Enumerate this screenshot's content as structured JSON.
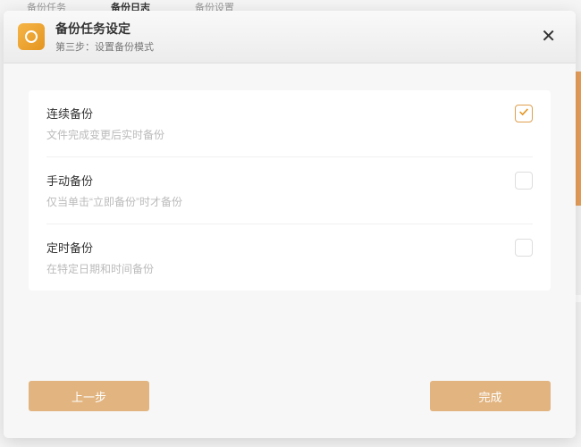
{
  "bgTabs": [
    "备份任务",
    "备份日志",
    "备份设置"
  ],
  "header": {
    "title": "备份任务设定",
    "subtitle": "第三步：设置备份模式"
  },
  "options": [
    {
      "label": "连续备份",
      "desc": "文件完成变更后实时备份",
      "checked": true
    },
    {
      "label": "手动备份",
      "desc": "仅当单击“立即备份”时才备份",
      "checked": false
    },
    {
      "label": "定时备份",
      "desc": "在特定日期和时间备份",
      "checked": false
    }
  ],
  "buttons": {
    "prev": "上一步",
    "done": "完成"
  }
}
